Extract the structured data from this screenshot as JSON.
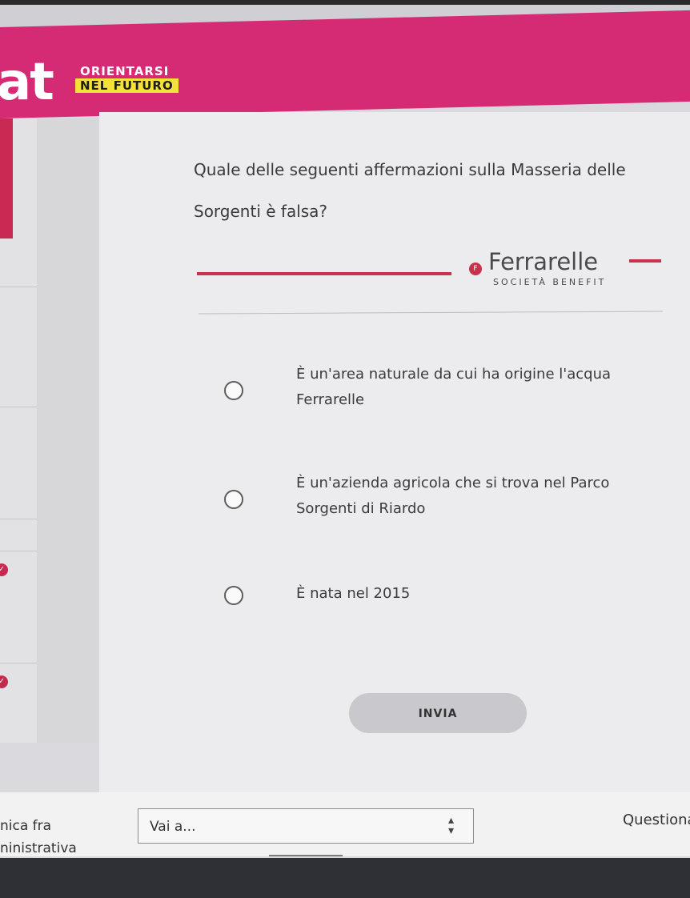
{
  "header": {
    "brand_fragment": "at",
    "badge_line1": "ORIENTARSI",
    "badge_line2": "NEL FUTURO",
    "color": "#d52a74"
  },
  "quiz": {
    "question": "Quale delle seguenti affermazioni sulla Masseria delle Sorgenti è falsa?",
    "logo": {
      "name": "Ferrarelle",
      "subtitle": "SOCIETÀ BENEFIT",
      "color": "#c8324a"
    },
    "options": [
      {
        "label": "È  un'area naturale da cui ha origine l'acqua Ferrarelle",
        "selected": false
      },
      {
        "label": "È un'azienda agricola che si trova nel Parco Sorgenti di Riardo",
        "selected": false
      },
      {
        "label": "È nata nel 2015",
        "selected": false
      }
    ],
    "submit_label": "INVIA"
  },
  "footer": {
    "left_line1": "nica fra",
    "left_line2": "ninistrativa",
    "select_label": "Vai a...",
    "right_label": "Questiona"
  }
}
